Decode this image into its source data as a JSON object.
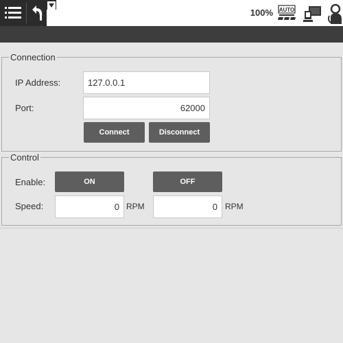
{
  "toolbar": {
    "speed_slider_value": "100%",
    "icons": [
      "menu-icon",
      "undo-icon",
      "dropdown-arrow-icon",
      "auto-mode-icon",
      "remote-control-icon",
      "user-icon"
    ],
    "auto_label": "AUTO"
  },
  "connection": {
    "group_title": "Connection",
    "ip_label": "IP Address:",
    "ip_value": "127.0.0.1",
    "port_label": "Port:",
    "port_value": "62000",
    "connect_label": "Connect",
    "disconnect_label": "Disconnect"
  },
  "control": {
    "group_title": "Control",
    "enable_label": "Enable:",
    "on_label": "ON",
    "off_label": "OFF",
    "speed_label": "Speed:",
    "speed_left_value": "0",
    "speed_right_value": "0",
    "unit_left": "RPM",
    "unit_right": "RPM"
  },
  "colors": {
    "toolbar_dark": "#2b2b2b",
    "band": "#3d3d3d",
    "background": "#e6e6e6",
    "button": "#5e5e5e"
  }
}
